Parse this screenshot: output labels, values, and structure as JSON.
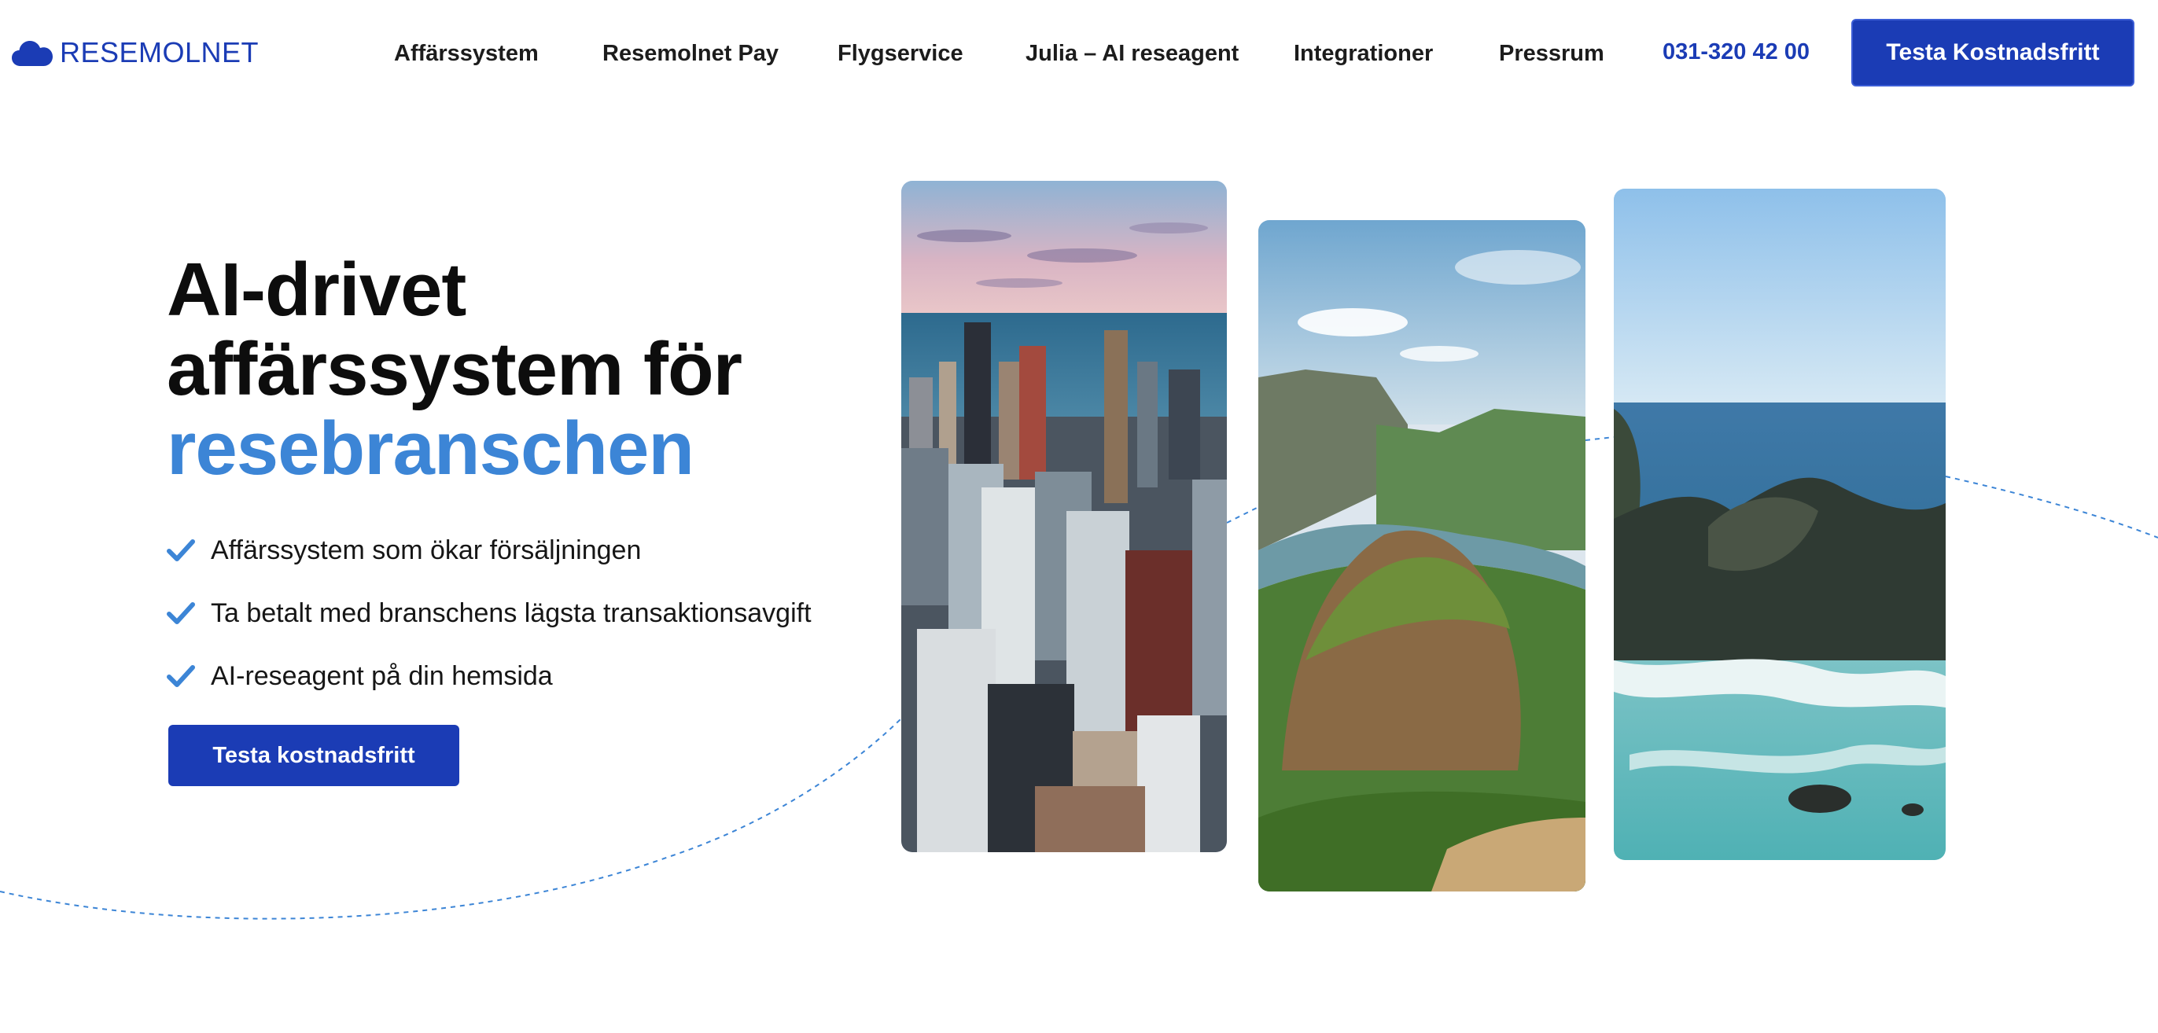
{
  "brand": {
    "name": "RESEMOLNET",
    "logo_icon": "cloud-icon",
    "color": "#1b3cb5"
  },
  "nav": {
    "items": [
      {
        "label": "Affärssystem"
      },
      {
        "label": "Resemolnet Pay"
      },
      {
        "label": "Flygservice"
      },
      {
        "label": "Julia – AI reseagent"
      },
      {
        "label": "Integrationer"
      },
      {
        "label": "Pressrum"
      }
    ],
    "phone": "031-320 42 00",
    "cta_label": "Testa Kostnadsfritt"
  },
  "hero": {
    "title_line1": "AI-drivet",
    "title_line2": "affärssystem för",
    "title_accent": "resebranschen",
    "accent_color": "#3c85d6",
    "bullets": [
      {
        "icon": "check-icon",
        "text": "Affärssystem som ökar försäljningen"
      },
      {
        "icon": "check-icon",
        "text": "Ta betalt med branschens lägsta transaktionsavgift"
      },
      {
        "icon": "check-icon",
        "text": "AI-reseagent på din hemsida"
      }
    ],
    "cta_label": "Testa kostnadsfritt"
  },
  "gallery": {
    "images": [
      {
        "subject": "city-skyline"
      },
      {
        "subject": "mountain-canyon"
      },
      {
        "subject": "ocean-coast"
      }
    ]
  },
  "colors": {
    "primary": "#1b3cb5",
    "accent": "#3c85d6",
    "text": "#111111"
  }
}
